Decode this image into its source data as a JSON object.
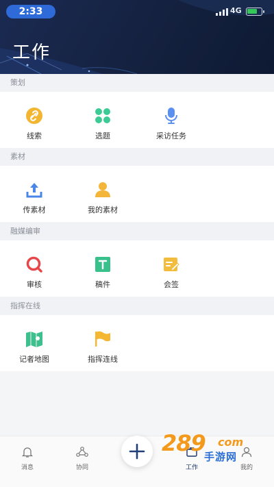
{
  "status_bar": {
    "time": "2:33",
    "network": "4G"
  },
  "header": {
    "title": "工作"
  },
  "sections": [
    {
      "title": "策划",
      "items": [
        {
          "label": "线索",
          "icon": "link-icon"
        },
        {
          "label": "选题",
          "icon": "clover-icon"
        },
        {
          "label": "采访任务",
          "icon": "microphone-icon"
        }
      ]
    },
    {
      "title": "素材",
      "items": [
        {
          "label": "传素材",
          "icon": "upload-icon"
        },
        {
          "label": "我的素材",
          "icon": "user-folder-icon"
        }
      ]
    },
    {
      "title": "融媒编审",
      "items": [
        {
          "label": "审核",
          "icon": "review-search-icon"
        },
        {
          "label": "稿件",
          "icon": "manuscript-icon"
        },
        {
          "label": "会签",
          "icon": "countersign-icon"
        }
      ]
    },
    {
      "title": "指挥在线",
      "items": [
        {
          "label": "记者地图",
          "icon": "map-icon"
        },
        {
          "label": "指挥连线",
          "icon": "flag-icon"
        }
      ]
    }
  ],
  "bottom_nav": [
    {
      "label": "消息",
      "icon": "bell-icon"
    },
    {
      "label": "协同",
      "icon": "network-icon"
    },
    {
      "label": "工作",
      "icon": "work-icon",
      "active": true
    },
    {
      "label": "我的",
      "icon": "profile-icon"
    }
  ],
  "watermark": {
    "number": "289",
    "suffix": "com",
    "text": "手游网"
  },
  "colors": {
    "header_bg": "#14213f",
    "time_pill": "#2e6bd8",
    "link": "#f2b632",
    "clover": "#3ccb94",
    "mic": "#5b8ff0",
    "upload": "#4a86e8",
    "user": "#f3b53a",
    "review": "#e8474a",
    "manuscript": "#39c18c",
    "countersign": "#f2bc3c",
    "map": "#3fbf8e",
    "flag": "#f5b731",
    "fab_plus": "#1f3f78"
  }
}
